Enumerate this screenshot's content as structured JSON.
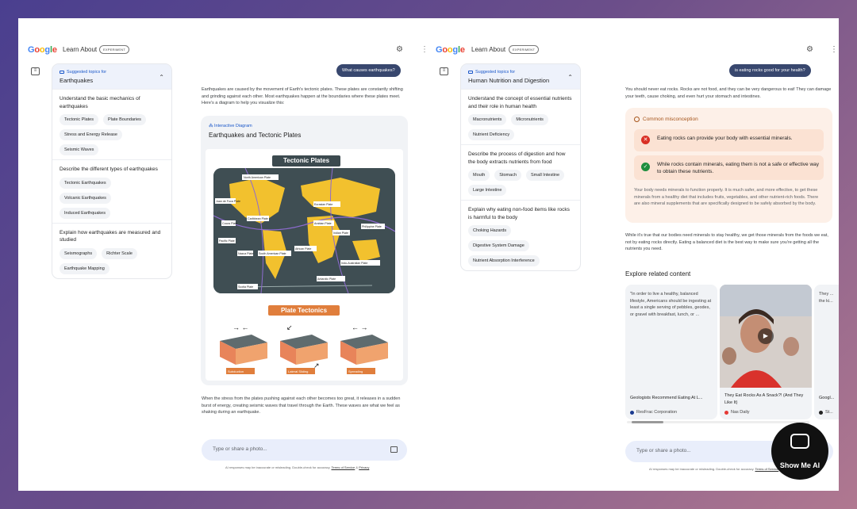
{
  "left": {
    "brand": "Google",
    "app_title": "Learn About",
    "badge": "EXPERIMENT",
    "sidebar": {
      "suggested_label": "Suggested topics for",
      "topic": "Earthquakes",
      "sections": [
        {
          "question": "Understand the basic mechanics of earthquakes",
          "chips": [
            "Tectonic Plates",
            "Plate Boundaries",
            "Stress and Energy Release",
            "Seismic Waves"
          ]
        },
        {
          "question": "Describe the different types of earthquakes",
          "chips": [
            "Tectonic Earthquakes",
            "Volcanic Earthquakes",
            "Induced Earthquakes"
          ]
        },
        {
          "question": "Explain how earthquakes are measured and studied",
          "chips": [
            "Seismographs",
            "Richter Scale",
            "Earthquake Mapping"
          ]
        }
      ]
    },
    "user_query": "What causes earthquakes?",
    "answer_intro": "Earthquakes are caused by the movement of Earth's tectonic plates. These plates are constantly shifting and grinding against each other. Most earthquakes happen at the boundaries where these plates meet. Here's a diagram to help you visualize this:",
    "diagram": {
      "tag": "Interactive Diagram",
      "title": "Earthquakes and Tectonic Plates",
      "banner_top": "Tectonic Plates",
      "banner_bottom": "Plate Tectonics",
      "plates": [
        "North American Plate",
        "Juan de Fuca Plate",
        "Cocos Plate",
        "Caribbean Plate",
        "Pacific Plate",
        "Nazca Plate",
        "South American Plate",
        "Eurasian Plate",
        "Arabian Plate",
        "Indian Plate",
        "Philippine Plate",
        "African Plate",
        "Indo-Australian Plate",
        "Antarctic Plate",
        "Scotia Plate"
      ],
      "blocks": [
        "Subduction",
        "Lateral Sliding",
        "Spreading"
      ]
    },
    "answer_outro": "When the stress from the plates pushing against each other becomes too great, it releases in a sudden burst of energy, creating seismic waves that travel through the Earth. These waves are what we feel as shaking during an earthquake.",
    "input_placeholder": "Type or share a photo...",
    "disclaimer": "AI responses may be inaccurate or misleading. Double-check for accuracy.",
    "terms": "Terms of Service",
    "and": "&",
    "privacy": "Privacy"
  },
  "right": {
    "brand": "Google",
    "app_title": "Learn About",
    "badge": "EXPERIMENT",
    "sidebar": {
      "suggested_label": "Suggested topics for",
      "topic": "Human Nutrition and Digestion",
      "sections": [
        {
          "question": "Understand the concept of essential nutrients and their role in human health",
          "chips": [
            "Macronutrients",
            "Micronutrients",
            "Nutrient Deficiency"
          ]
        },
        {
          "question": "Describe the process of digestion and how the body extracts nutrients from food",
          "chips": [
            "Mouth",
            "Stomach",
            "Small Intestine",
            "Large Intestine"
          ]
        },
        {
          "question": "Explain why eating non-food items like rocks is harmful to the body",
          "chips": [
            "Choking Hazards",
            "Digestive System Damage",
            "Nutrient Absorption Interference"
          ]
        }
      ]
    },
    "user_query": "is eating rocks good for your health?",
    "answer_intro": "You should never eat rocks. Rocks are not food, and they can be very dangerous to eat! They can damage your teeth, cause choking, and even hurt your stomach and intestines.",
    "misconception": {
      "title": "Common misconception",
      "false_claim": "Eating rocks can provide your body with essential minerals.",
      "true_claim": "While rocks contain minerals, eating them is not a safe or effective way to obtain these nutrients.",
      "note": "Your body needs minerals to function properly. It is much safer, and more effective, to get these minerals from a healthy diet that includes fruits, vegetables, and other nutrient-rich foods. There are also mineral supplements that are specifically designed to be safely absorbed by the body."
    },
    "answer_outro": "While it's true that our bodies need minerals to stay healthy, we get those minerals from the foods we eat, not by eating rocks directly. Eating a balanced diet is the best way to make sure you're getting all the nutrients you need.",
    "related_title": "Explore related content",
    "cards": [
      {
        "quote": "\"In order to live a healthy, balanced lifestyle, Americans should be ingesting at least a single serving of pebbles, geodes, or gravel with breakfast, lunch, or ...",
        "title": "Geologists Recommend Eating At L...",
        "source": "ResFrac Corporation",
        "color": "#1a3a8f"
      },
      {
        "quote": "",
        "title": "They Eat Rocks As A Snack?! (And They Like It)",
        "source": "Nas Daily",
        "color": "#e53935"
      },
      {
        "quote": "They ... the ki...",
        "title": "Googl...",
        "source": "St...",
        "color": "#222222"
      }
    ],
    "input_placeholder": "Type or share a photo...",
    "disclaimer": "AI responses may be inaccurate or misleading. Double-check for accuracy.",
    "terms": "Terms of Service",
    "and": "&",
    "privacy": "Privacy"
  },
  "watermark": "Show Me AI"
}
